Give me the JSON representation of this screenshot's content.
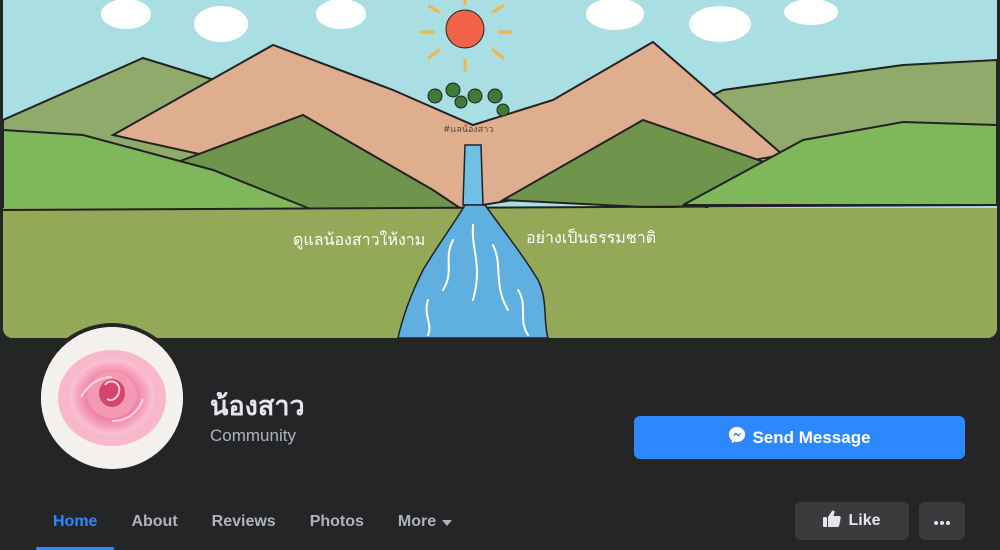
{
  "page": {
    "name": "น้องสาว",
    "category": "Community"
  },
  "cover": {
    "caption_left": "ดูแลน้องสาวให้งาม",
    "caption_right": "อย่างเป็นธรรมชาติ",
    "hashtag": "#แลน้องสาว"
  },
  "actions": {
    "send_message_label": "Send Message",
    "like_label": "Like"
  },
  "tabs": [
    {
      "label": "Home"
    },
    {
      "label": "About"
    },
    {
      "label": "Reviews"
    },
    {
      "label": "Photos"
    },
    {
      "label": "More"
    }
  ],
  "icons": {
    "messenger": "messenger-icon",
    "like": "thumbs-up-icon",
    "more_tab": "caret-down-icon",
    "more_actions": "ellipsis-icon"
  },
  "colors": {
    "accent": "#2d88ff",
    "background": "#242526",
    "button_secondary": "#3a3b3c"
  }
}
